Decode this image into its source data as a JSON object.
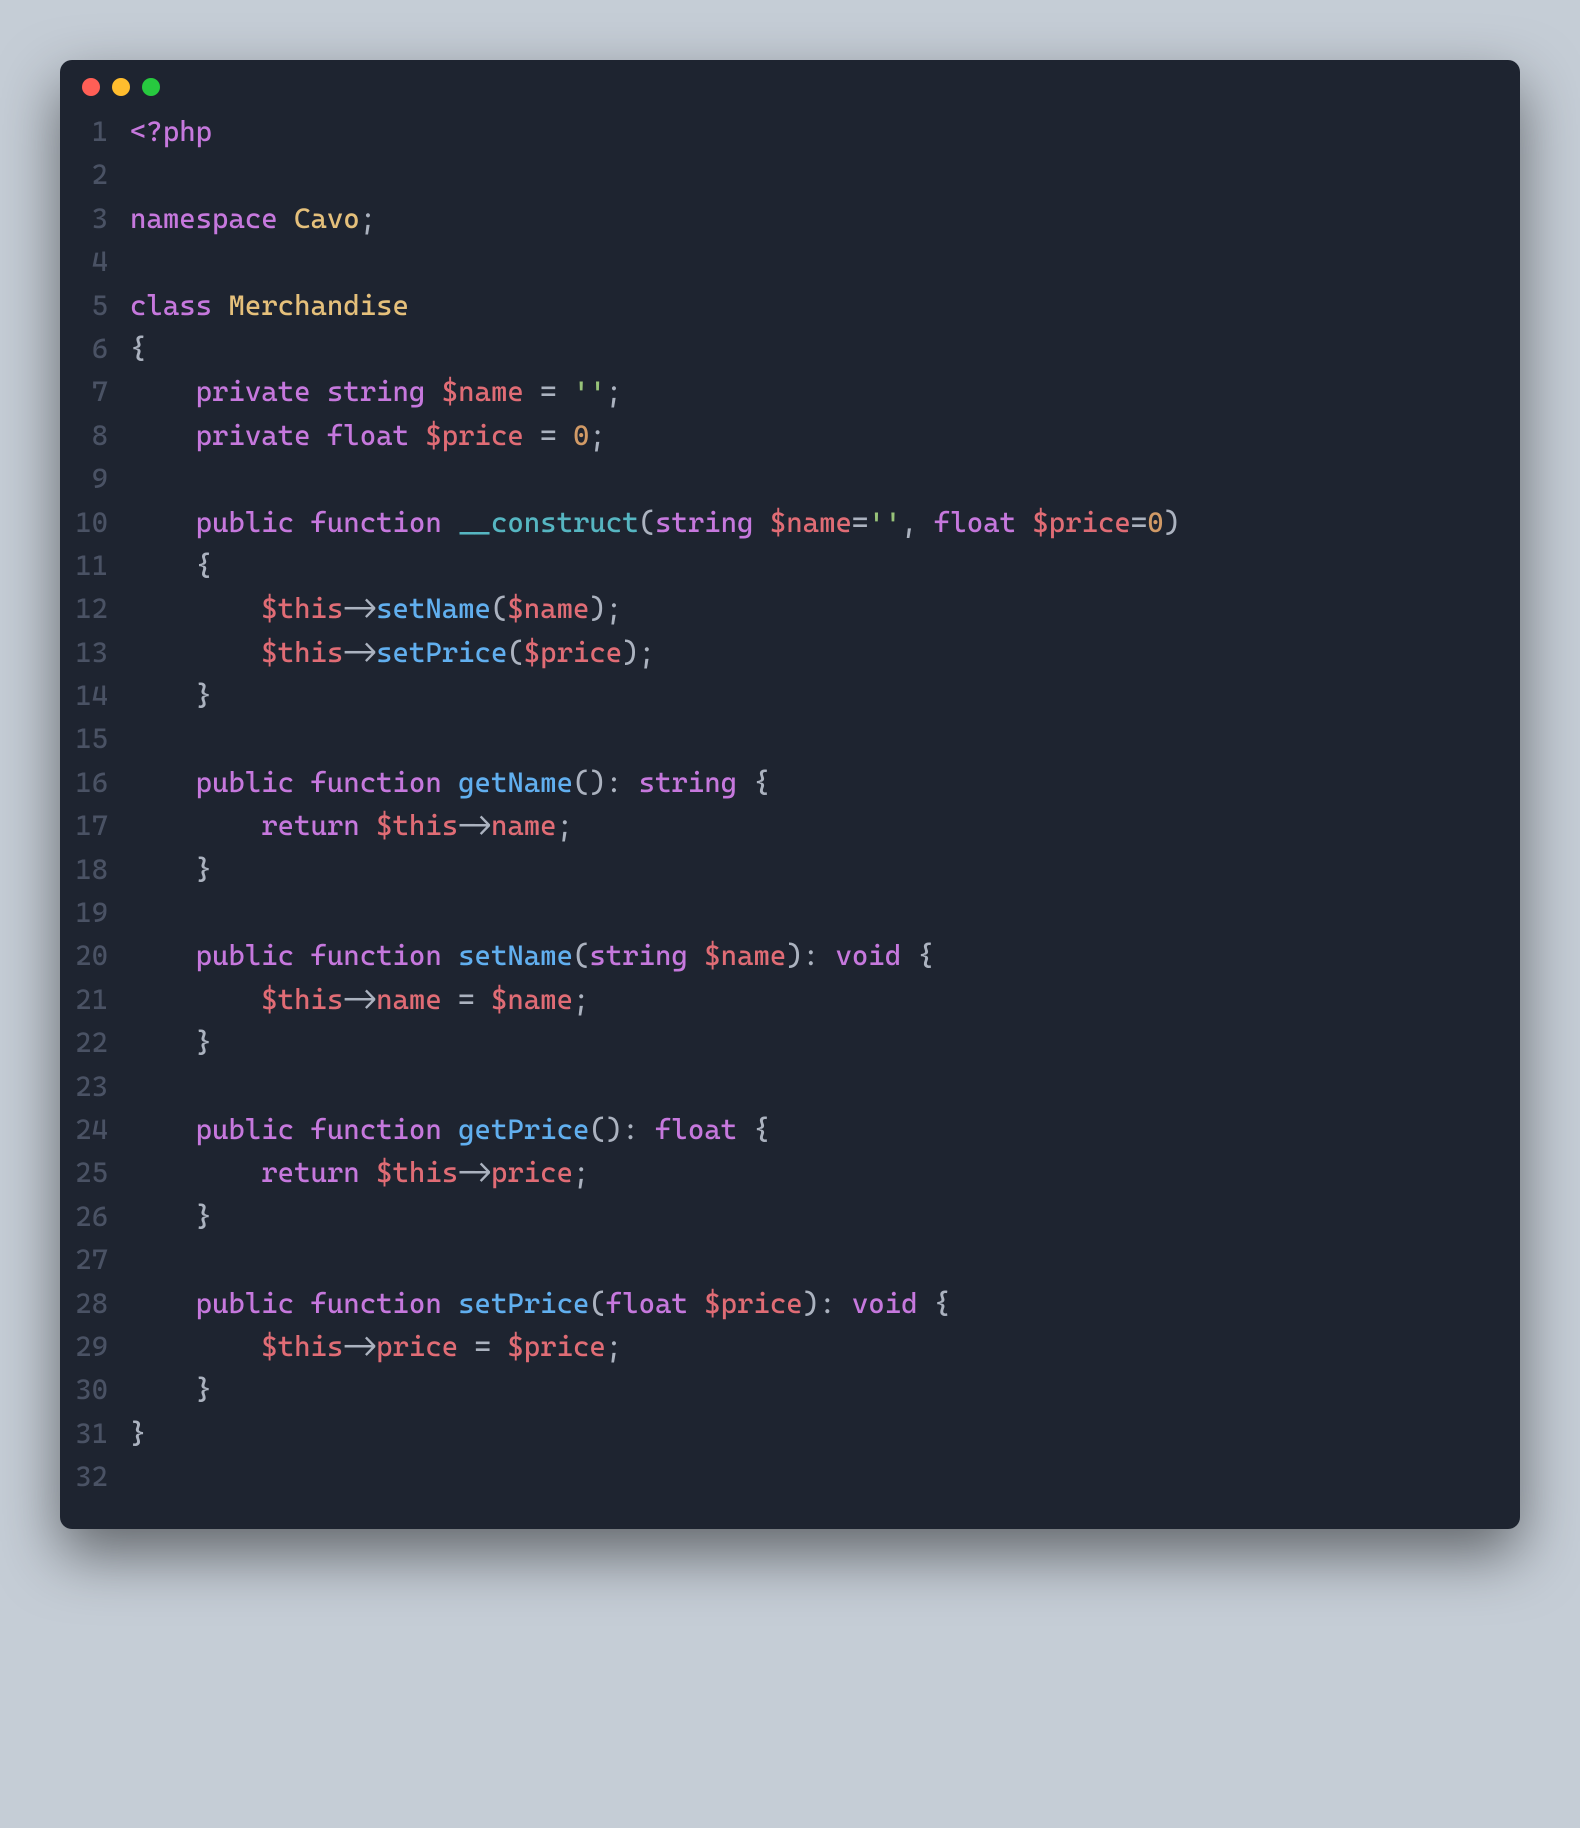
{
  "window": {
    "traffic_lights": [
      "close",
      "minimize",
      "zoom"
    ]
  },
  "code": {
    "lines": [
      [
        {
          "c": "k",
          "t": "<?php"
        }
      ],
      [],
      [
        {
          "c": "k",
          "t": "namespace"
        },
        {
          "c": "p",
          "t": " "
        },
        {
          "c": "ns",
          "t": "Cavo"
        },
        {
          "c": "p",
          "t": ";"
        }
      ],
      [],
      [
        {
          "c": "k",
          "t": "class"
        },
        {
          "c": "p",
          "t": " "
        },
        {
          "c": "cls",
          "t": "Merchandise"
        }
      ],
      [
        {
          "c": "p",
          "t": "{"
        }
      ],
      [
        {
          "c": "p",
          "t": "    "
        },
        {
          "c": "k",
          "t": "private"
        },
        {
          "c": "p",
          "t": " "
        },
        {
          "c": "t",
          "t": "string"
        },
        {
          "c": "p",
          "t": " "
        },
        {
          "c": "v",
          "t": "$name"
        },
        {
          "c": "p",
          "t": " = "
        },
        {
          "c": "s",
          "t": "''"
        },
        {
          "c": "p",
          "t": ";"
        }
      ],
      [
        {
          "c": "p",
          "t": "    "
        },
        {
          "c": "k",
          "t": "private"
        },
        {
          "c": "p",
          "t": " "
        },
        {
          "c": "t",
          "t": "float"
        },
        {
          "c": "p",
          "t": " "
        },
        {
          "c": "v",
          "t": "$price"
        },
        {
          "c": "p",
          "t": " = "
        },
        {
          "c": "n",
          "t": "0"
        },
        {
          "c": "p",
          "t": ";"
        }
      ],
      [],
      [
        {
          "c": "p",
          "t": "    "
        },
        {
          "c": "k",
          "t": "public"
        },
        {
          "c": "p",
          "t": " "
        },
        {
          "c": "k",
          "t": "function"
        },
        {
          "c": "p",
          "t": " "
        },
        {
          "c": "mg",
          "t": "__construct"
        },
        {
          "c": "p",
          "t": "("
        },
        {
          "c": "t",
          "t": "string"
        },
        {
          "c": "p",
          "t": " "
        },
        {
          "c": "v",
          "t": "$name"
        },
        {
          "c": "p",
          "t": "="
        },
        {
          "c": "s",
          "t": "''"
        },
        {
          "c": "p",
          "t": ", "
        },
        {
          "c": "t",
          "t": "float"
        },
        {
          "c": "p",
          "t": " "
        },
        {
          "c": "v",
          "t": "$price"
        },
        {
          "c": "p",
          "t": "="
        },
        {
          "c": "n",
          "t": "0"
        },
        {
          "c": "p",
          "t": ")"
        }
      ],
      [
        {
          "c": "p",
          "t": "    {"
        }
      ],
      [
        {
          "c": "p",
          "t": "        "
        },
        {
          "c": "v",
          "t": "$this"
        },
        {
          "c": "p",
          "t": "->"
        },
        {
          "c": "fn",
          "t": "setName"
        },
        {
          "c": "p",
          "t": "("
        },
        {
          "c": "v",
          "t": "$name"
        },
        {
          "c": "p",
          "t": ");"
        }
      ],
      [
        {
          "c": "p",
          "t": "        "
        },
        {
          "c": "v",
          "t": "$this"
        },
        {
          "c": "p",
          "t": "->"
        },
        {
          "c": "fn",
          "t": "setPrice"
        },
        {
          "c": "p",
          "t": "("
        },
        {
          "c": "v",
          "t": "$price"
        },
        {
          "c": "p",
          "t": ");"
        }
      ],
      [
        {
          "c": "p",
          "t": "    }"
        }
      ],
      [],
      [
        {
          "c": "p",
          "t": "    "
        },
        {
          "c": "k",
          "t": "public"
        },
        {
          "c": "p",
          "t": " "
        },
        {
          "c": "k",
          "t": "function"
        },
        {
          "c": "p",
          "t": " "
        },
        {
          "c": "fn",
          "t": "getName"
        },
        {
          "c": "p",
          "t": "(): "
        },
        {
          "c": "t",
          "t": "string"
        },
        {
          "c": "p",
          "t": " {"
        }
      ],
      [
        {
          "c": "p",
          "t": "        "
        },
        {
          "c": "k",
          "t": "return"
        },
        {
          "c": "p",
          "t": " "
        },
        {
          "c": "v",
          "t": "$this"
        },
        {
          "c": "p",
          "t": "->"
        },
        {
          "c": "prop",
          "t": "name"
        },
        {
          "c": "p",
          "t": ";"
        }
      ],
      [
        {
          "c": "p",
          "t": "    }"
        }
      ],
      [],
      [
        {
          "c": "p",
          "t": "    "
        },
        {
          "c": "k",
          "t": "public"
        },
        {
          "c": "p",
          "t": " "
        },
        {
          "c": "k",
          "t": "function"
        },
        {
          "c": "p",
          "t": " "
        },
        {
          "c": "fn",
          "t": "setName"
        },
        {
          "c": "p",
          "t": "("
        },
        {
          "c": "t",
          "t": "string"
        },
        {
          "c": "p",
          "t": " "
        },
        {
          "c": "v",
          "t": "$name"
        },
        {
          "c": "p",
          "t": "): "
        },
        {
          "c": "t",
          "t": "void"
        },
        {
          "c": "p",
          "t": " {"
        }
      ],
      [
        {
          "c": "p",
          "t": "        "
        },
        {
          "c": "v",
          "t": "$this"
        },
        {
          "c": "p",
          "t": "->"
        },
        {
          "c": "prop",
          "t": "name"
        },
        {
          "c": "p",
          "t": " = "
        },
        {
          "c": "v",
          "t": "$name"
        },
        {
          "c": "p",
          "t": ";"
        }
      ],
      [
        {
          "c": "p",
          "t": "    }"
        }
      ],
      [],
      [
        {
          "c": "p",
          "t": "    "
        },
        {
          "c": "k",
          "t": "public"
        },
        {
          "c": "p",
          "t": " "
        },
        {
          "c": "k",
          "t": "function"
        },
        {
          "c": "p",
          "t": " "
        },
        {
          "c": "fn",
          "t": "getPrice"
        },
        {
          "c": "p",
          "t": "(): "
        },
        {
          "c": "t",
          "t": "float"
        },
        {
          "c": "p",
          "t": " {"
        }
      ],
      [
        {
          "c": "p",
          "t": "        "
        },
        {
          "c": "k",
          "t": "return"
        },
        {
          "c": "p",
          "t": " "
        },
        {
          "c": "v",
          "t": "$this"
        },
        {
          "c": "p",
          "t": "->"
        },
        {
          "c": "prop",
          "t": "price"
        },
        {
          "c": "p",
          "t": ";"
        }
      ],
      [
        {
          "c": "p",
          "t": "    }"
        }
      ],
      [],
      [
        {
          "c": "p",
          "t": "    "
        },
        {
          "c": "k",
          "t": "public"
        },
        {
          "c": "p",
          "t": " "
        },
        {
          "c": "k",
          "t": "function"
        },
        {
          "c": "p",
          "t": " "
        },
        {
          "c": "fn",
          "t": "setPrice"
        },
        {
          "c": "p",
          "t": "("
        },
        {
          "c": "t",
          "t": "float"
        },
        {
          "c": "p",
          "t": " "
        },
        {
          "c": "v",
          "t": "$price"
        },
        {
          "c": "p",
          "t": "): "
        },
        {
          "c": "t",
          "t": "void"
        },
        {
          "c": "p",
          "t": " {"
        }
      ],
      [
        {
          "c": "p",
          "t": "        "
        },
        {
          "c": "v",
          "t": "$this"
        },
        {
          "c": "p",
          "t": "->"
        },
        {
          "c": "prop",
          "t": "price"
        },
        {
          "c": "p",
          "t": " = "
        },
        {
          "c": "v",
          "t": "$price"
        },
        {
          "c": "p",
          "t": ";"
        }
      ],
      [
        {
          "c": "p",
          "t": "    }"
        }
      ],
      [
        {
          "c": "p",
          "t": "}"
        }
      ],
      []
    ]
  }
}
